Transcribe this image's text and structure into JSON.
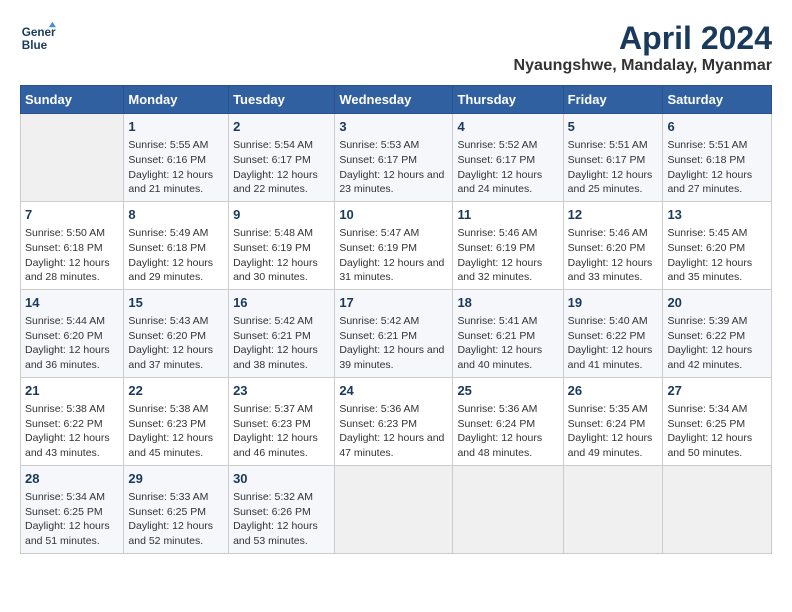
{
  "header": {
    "logo_line1": "General",
    "logo_line2": "Blue",
    "month_title": "April 2024",
    "location": "Nyaungshwe, Mandalay, Myanmar"
  },
  "weekdays": [
    "Sunday",
    "Monday",
    "Tuesday",
    "Wednesday",
    "Thursday",
    "Friday",
    "Saturday"
  ],
  "weeks": [
    [
      {
        "day": "",
        "sunrise": "",
        "sunset": "",
        "daylight": ""
      },
      {
        "day": "1",
        "sunrise": "Sunrise: 5:55 AM",
        "sunset": "Sunset: 6:16 PM",
        "daylight": "Daylight: 12 hours and 21 minutes."
      },
      {
        "day": "2",
        "sunrise": "Sunrise: 5:54 AM",
        "sunset": "Sunset: 6:17 PM",
        "daylight": "Daylight: 12 hours and 22 minutes."
      },
      {
        "day": "3",
        "sunrise": "Sunrise: 5:53 AM",
        "sunset": "Sunset: 6:17 PM",
        "daylight": "Daylight: 12 hours and 23 minutes."
      },
      {
        "day": "4",
        "sunrise": "Sunrise: 5:52 AM",
        "sunset": "Sunset: 6:17 PM",
        "daylight": "Daylight: 12 hours and 24 minutes."
      },
      {
        "day": "5",
        "sunrise": "Sunrise: 5:51 AM",
        "sunset": "Sunset: 6:17 PM",
        "daylight": "Daylight: 12 hours and 25 minutes."
      },
      {
        "day": "6",
        "sunrise": "Sunrise: 5:51 AM",
        "sunset": "Sunset: 6:18 PM",
        "daylight": "Daylight: 12 hours and 27 minutes."
      }
    ],
    [
      {
        "day": "7",
        "sunrise": "Sunrise: 5:50 AM",
        "sunset": "Sunset: 6:18 PM",
        "daylight": "Daylight: 12 hours and 28 minutes."
      },
      {
        "day": "8",
        "sunrise": "Sunrise: 5:49 AM",
        "sunset": "Sunset: 6:18 PM",
        "daylight": "Daylight: 12 hours and 29 minutes."
      },
      {
        "day": "9",
        "sunrise": "Sunrise: 5:48 AM",
        "sunset": "Sunset: 6:19 PM",
        "daylight": "Daylight: 12 hours and 30 minutes."
      },
      {
        "day": "10",
        "sunrise": "Sunrise: 5:47 AM",
        "sunset": "Sunset: 6:19 PM",
        "daylight": "Daylight: 12 hours and 31 minutes."
      },
      {
        "day": "11",
        "sunrise": "Sunrise: 5:46 AM",
        "sunset": "Sunset: 6:19 PM",
        "daylight": "Daylight: 12 hours and 32 minutes."
      },
      {
        "day": "12",
        "sunrise": "Sunrise: 5:46 AM",
        "sunset": "Sunset: 6:20 PM",
        "daylight": "Daylight: 12 hours and 33 minutes."
      },
      {
        "day": "13",
        "sunrise": "Sunrise: 5:45 AM",
        "sunset": "Sunset: 6:20 PM",
        "daylight": "Daylight: 12 hours and 35 minutes."
      }
    ],
    [
      {
        "day": "14",
        "sunrise": "Sunrise: 5:44 AM",
        "sunset": "Sunset: 6:20 PM",
        "daylight": "Daylight: 12 hours and 36 minutes."
      },
      {
        "day": "15",
        "sunrise": "Sunrise: 5:43 AM",
        "sunset": "Sunset: 6:20 PM",
        "daylight": "Daylight: 12 hours and 37 minutes."
      },
      {
        "day": "16",
        "sunrise": "Sunrise: 5:42 AM",
        "sunset": "Sunset: 6:21 PM",
        "daylight": "Daylight: 12 hours and 38 minutes."
      },
      {
        "day": "17",
        "sunrise": "Sunrise: 5:42 AM",
        "sunset": "Sunset: 6:21 PM",
        "daylight": "Daylight: 12 hours and 39 minutes."
      },
      {
        "day": "18",
        "sunrise": "Sunrise: 5:41 AM",
        "sunset": "Sunset: 6:21 PM",
        "daylight": "Daylight: 12 hours and 40 minutes."
      },
      {
        "day": "19",
        "sunrise": "Sunrise: 5:40 AM",
        "sunset": "Sunset: 6:22 PM",
        "daylight": "Daylight: 12 hours and 41 minutes."
      },
      {
        "day": "20",
        "sunrise": "Sunrise: 5:39 AM",
        "sunset": "Sunset: 6:22 PM",
        "daylight": "Daylight: 12 hours and 42 minutes."
      }
    ],
    [
      {
        "day": "21",
        "sunrise": "Sunrise: 5:38 AM",
        "sunset": "Sunset: 6:22 PM",
        "daylight": "Daylight: 12 hours and 43 minutes."
      },
      {
        "day": "22",
        "sunrise": "Sunrise: 5:38 AM",
        "sunset": "Sunset: 6:23 PM",
        "daylight": "Daylight: 12 hours and 45 minutes."
      },
      {
        "day": "23",
        "sunrise": "Sunrise: 5:37 AM",
        "sunset": "Sunset: 6:23 PM",
        "daylight": "Daylight: 12 hours and 46 minutes."
      },
      {
        "day": "24",
        "sunrise": "Sunrise: 5:36 AM",
        "sunset": "Sunset: 6:23 PM",
        "daylight": "Daylight: 12 hours and 47 minutes."
      },
      {
        "day": "25",
        "sunrise": "Sunrise: 5:36 AM",
        "sunset": "Sunset: 6:24 PM",
        "daylight": "Daylight: 12 hours and 48 minutes."
      },
      {
        "day": "26",
        "sunrise": "Sunrise: 5:35 AM",
        "sunset": "Sunset: 6:24 PM",
        "daylight": "Daylight: 12 hours and 49 minutes."
      },
      {
        "day": "27",
        "sunrise": "Sunrise: 5:34 AM",
        "sunset": "Sunset: 6:25 PM",
        "daylight": "Daylight: 12 hours and 50 minutes."
      }
    ],
    [
      {
        "day": "28",
        "sunrise": "Sunrise: 5:34 AM",
        "sunset": "Sunset: 6:25 PM",
        "daylight": "Daylight: 12 hours and 51 minutes."
      },
      {
        "day": "29",
        "sunrise": "Sunrise: 5:33 AM",
        "sunset": "Sunset: 6:25 PM",
        "daylight": "Daylight: 12 hours and 52 minutes."
      },
      {
        "day": "30",
        "sunrise": "Sunrise: 5:32 AM",
        "sunset": "Sunset: 6:26 PM",
        "daylight": "Daylight: 12 hours and 53 minutes."
      },
      {
        "day": "",
        "sunrise": "",
        "sunset": "",
        "daylight": ""
      },
      {
        "day": "",
        "sunrise": "",
        "sunset": "",
        "daylight": ""
      },
      {
        "day": "",
        "sunrise": "",
        "sunset": "",
        "daylight": ""
      },
      {
        "day": "",
        "sunrise": "",
        "sunset": "",
        "daylight": ""
      }
    ]
  ]
}
